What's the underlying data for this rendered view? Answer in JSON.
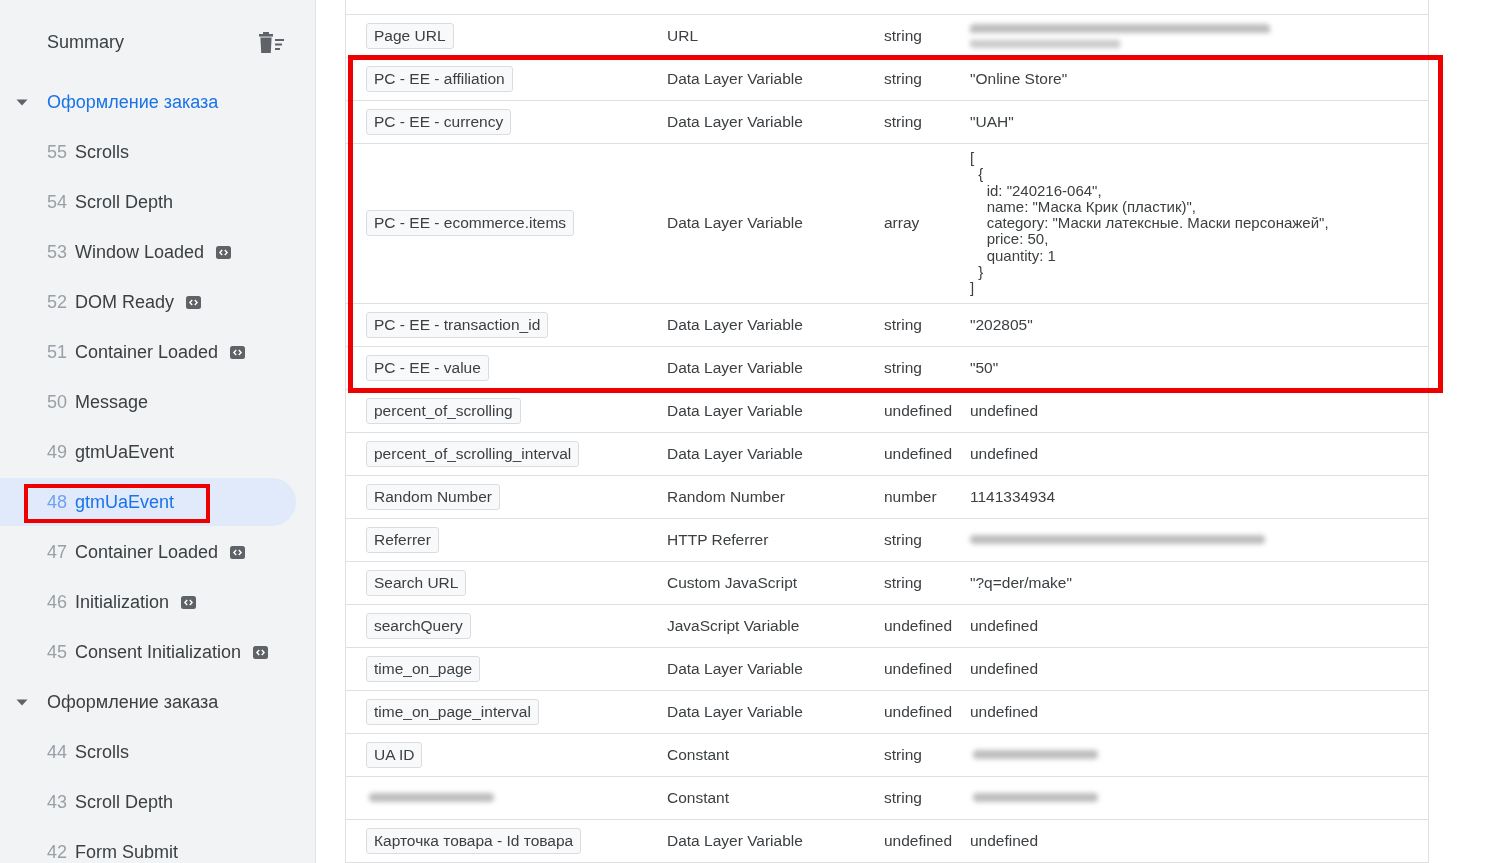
{
  "sidebar": {
    "summary": {
      "label": "Summary"
    },
    "groups": [
      {
        "label": "Оформление заказа",
        "expanded": true,
        "children": [
          {
            "number": "55",
            "label": "Scrolls",
            "code_icon": false,
            "selected": false,
            "highlighted": false
          },
          {
            "number": "54",
            "label": "Scroll Depth",
            "code_icon": false,
            "selected": false,
            "highlighted": false
          },
          {
            "number": "53",
            "label": "Window Loaded",
            "code_icon": true,
            "selected": false,
            "highlighted": false
          },
          {
            "number": "52",
            "label": "DOM Ready",
            "code_icon": true,
            "selected": false,
            "highlighted": false
          },
          {
            "number": "51",
            "label": "Container Loaded",
            "code_icon": true,
            "selected": false,
            "highlighted": false
          },
          {
            "number": "50",
            "label": "Message",
            "code_icon": false,
            "selected": false,
            "highlighted": false
          },
          {
            "number": "49",
            "label": "gtmUaEvent",
            "code_icon": false,
            "selected": false,
            "highlighted": false
          },
          {
            "number": "48",
            "label": "gtmUaEvent",
            "code_icon": false,
            "selected": true,
            "highlighted": true
          },
          {
            "number": "47",
            "label": "Container Loaded",
            "code_icon": true,
            "selected": false,
            "highlighted": false
          },
          {
            "number": "46",
            "label": "Initialization",
            "code_icon": true,
            "selected": false,
            "highlighted": false
          },
          {
            "number": "45",
            "label": "Consent Initialization",
            "code_icon": true,
            "selected": false,
            "highlighted": false
          }
        ]
      },
      {
        "label": "Оформление заказа",
        "expanded": true,
        "children": [
          {
            "number": "44",
            "label": "Scrolls",
            "code_icon": false,
            "selected": false,
            "highlighted": false
          },
          {
            "number": "43",
            "label": "Scroll Depth",
            "code_icon": false,
            "selected": false,
            "highlighted": false
          },
          {
            "number": "42",
            "label": "Form Submit",
            "code_icon": false,
            "selected": false,
            "highlighted": false
          }
        ]
      }
    ]
  },
  "variables_table": {
    "rows": [
      {
        "kind": "blurred-double",
        "name": "Page URL",
        "variable_type": "URL",
        "return_type": "string",
        "highlighted": false
      },
      {
        "kind": "plain",
        "name": "PC - EE - affiliation",
        "variable_type": "Data Layer Variable",
        "return_type": "string",
        "value": "\"Online Store\"",
        "highlighted": true
      },
      {
        "kind": "plain",
        "name": "PC - EE - currency",
        "variable_type": "Data Layer Variable",
        "return_type": "string",
        "value": "\"UAH\"",
        "highlighted": true
      },
      {
        "kind": "plain",
        "name": "PC - EE - ecommerce.items",
        "variable_type": "Data Layer Variable",
        "return_type": "array",
        "value": "[\n  {\n    id: \"240216-064\",\n    name: \"Маска Крик (пластик)\",\n    category: \"Маски латексные. Маски персонажей\",\n    price: 50,\n    quantity: 1\n  }\n]",
        "highlighted": true
      },
      {
        "kind": "plain",
        "name": "PC - EE - transaction_id",
        "variable_type": "Data Layer Variable",
        "return_type": "string",
        "value": "\"202805\"",
        "highlighted": true
      },
      {
        "kind": "plain",
        "name": "PC - EE - value",
        "variable_type": "Data Layer Variable",
        "return_type": "string",
        "value": "\"50\"",
        "highlighted": true
      },
      {
        "kind": "plain",
        "name": "percent_of_scrolling",
        "variable_type": "Data Layer Variable",
        "return_type": "undefined",
        "value": "undefined",
        "highlighted": false
      },
      {
        "kind": "plain",
        "name": "percent_of_scrolling_interval",
        "variable_type": "Data Layer Variable",
        "return_type": "undefined",
        "value": "undefined",
        "highlighted": false
      },
      {
        "kind": "plain",
        "name": "Random Number",
        "variable_type": "Random Number",
        "return_type": "number",
        "value": "1141334934",
        "highlighted": false
      },
      {
        "kind": "blurred-long",
        "name": "Referrer",
        "variable_type": "HTTP Referrer",
        "return_type": "string",
        "highlighted": false
      },
      {
        "kind": "plain",
        "name": "Search URL",
        "variable_type": "Custom JavaScript",
        "return_type": "string",
        "value": "\"?q=der/make\"",
        "highlighted": false
      },
      {
        "kind": "plain",
        "name": "searchQuery",
        "variable_type": "JavaScript Variable",
        "return_type": "undefined",
        "value": "undefined",
        "highlighted": false
      },
      {
        "kind": "plain",
        "name": "time_on_page",
        "variable_type": "Data Layer Variable",
        "return_type": "undefined",
        "value": "undefined",
        "highlighted": false
      },
      {
        "kind": "plain",
        "name": "time_on_page_interval",
        "variable_type": "Data Layer Variable",
        "return_type": "undefined",
        "value": "undefined",
        "highlighted": false
      },
      {
        "kind": "blurred-short",
        "name": "UA ID",
        "variable_type": "Constant",
        "return_type": "string",
        "highlighted": false
      },
      {
        "kind": "blurred-name",
        "variable_type": "Constant",
        "return_type": "string",
        "highlighted": false
      },
      {
        "kind": "plain",
        "name": "Карточка товара - Id товара",
        "variable_type": "Data Layer Variable",
        "return_type": "undefined",
        "value": "undefined",
        "highlighted": false
      }
    ]
  }
}
